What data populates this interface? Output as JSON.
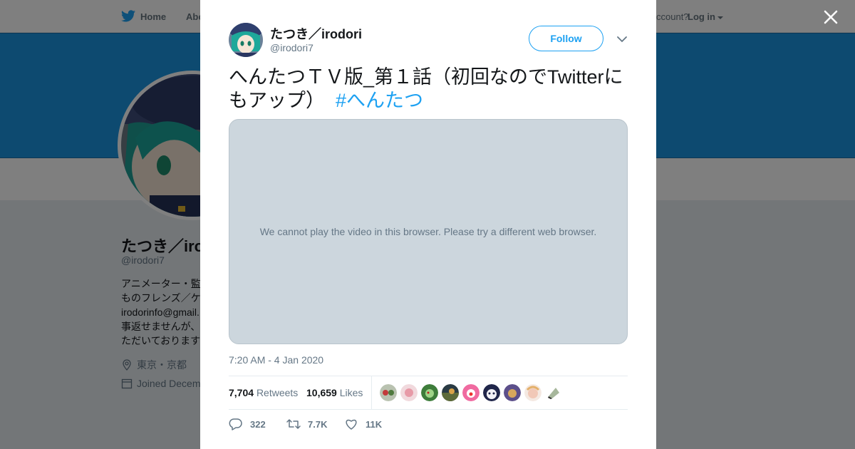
{
  "background": {
    "nav": {
      "home_label": "Home",
      "about_label": "Abo",
      "account_prompt": "ccount?",
      "login_label": "Log in"
    },
    "profile": {
      "name": "たつき／iro",
      "handle": "@irodori7",
      "bio_lines": [
        "アニメーター・監",
        "ものフレンズ／ケ",
        "irodorinfo@gmail.",
        "事返せませんが、",
        "ただいております"
      ],
      "location": "東京・京都",
      "joined": "Joined Decem"
    },
    "colors": {
      "banner": "#1b95e0",
      "accent": "#1da1f2"
    }
  },
  "modal": {
    "author": {
      "name": "たつき／irodori",
      "handle": "@irodori7"
    },
    "follow_label": "Follow",
    "tweet": {
      "text": "へんたつＴＶ版_第１話（初回なのでTwitterにもアップ）",
      "hashtag": "#へんたつ"
    },
    "video_message": "We cannot play the video in this browser. Please try a different web browser.",
    "timestamp": "7:20 AM - 4 Jan 2020",
    "stats": {
      "retweets_count": "7,704",
      "retweets_label": "Retweets",
      "likes_count": "10,659",
      "likes_label": "Likes"
    },
    "likers_count": 9,
    "actions": {
      "reply_count": "322",
      "retweet_count": "7.7K",
      "like_count": "11K"
    }
  }
}
